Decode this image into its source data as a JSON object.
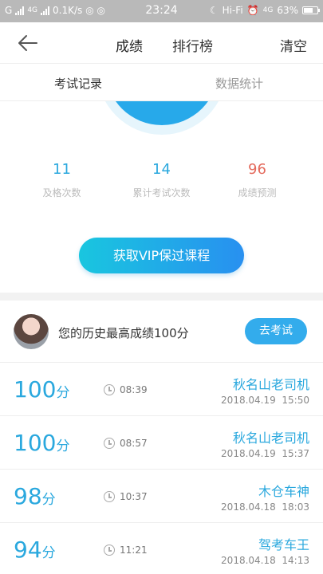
{
  "status_bar": {
    "carrier_left": "G",
    "net1": "4G",
    "speed": "0.1K/s",
    "time": "23:24",
    "hifi": "Hi-Fi",
    "net2": "4G",
    "battery": "63%"
  },
  "header": {
    "tabs": [
      {
        "label": "成绩"
      },
      {
        "label": "排行榜"
      }
    ],
    "clear_label": "清空"
  },
  "subtabs": [
    {
      "label": "考试记录"
    },
    {
      "label": "数据统计"
    }
  ],
  "stats": [
    {
      "value": "11",
      "label": "及格次数"
    },
    {
      "value": "14",
      "label": "累计考试次数"
    },
    {
      "value": "96",
      "label": "成绩预测"
    }
  ],
  "vip_button_label": "获取VIP保过课程",
  "best": {
    "text": "您的历史最高成绩100分",
    "button_label": "去考试"
  },
  "records": [
    {
      "score": "100",
      "unit": "分",
      "duration": "08:39",
      "name": "秋名山老司机",
      "date": "2018.04.19",
      "time": "15:50"
    },
    {
      "score": "100",
      "unit": "分",
      "duration": "08:57",
      "name": "秋名山老司机",
      "date": "2018.04.19",
      "time": "15:37"
    },
    {
      "score": "98",
      "unit": "分",
      "duration": "10:37",
      "name": "木仓车神",
      "date": "2018.04.18",
      "time": "18:03"
    },
    {
      "score": "94",
      "unit": "分",
      "duration": "11:21",
      "name": "驾考车王",
      "date": "2018.04.18",
      "time": "14:13"
    }
  ]
}
